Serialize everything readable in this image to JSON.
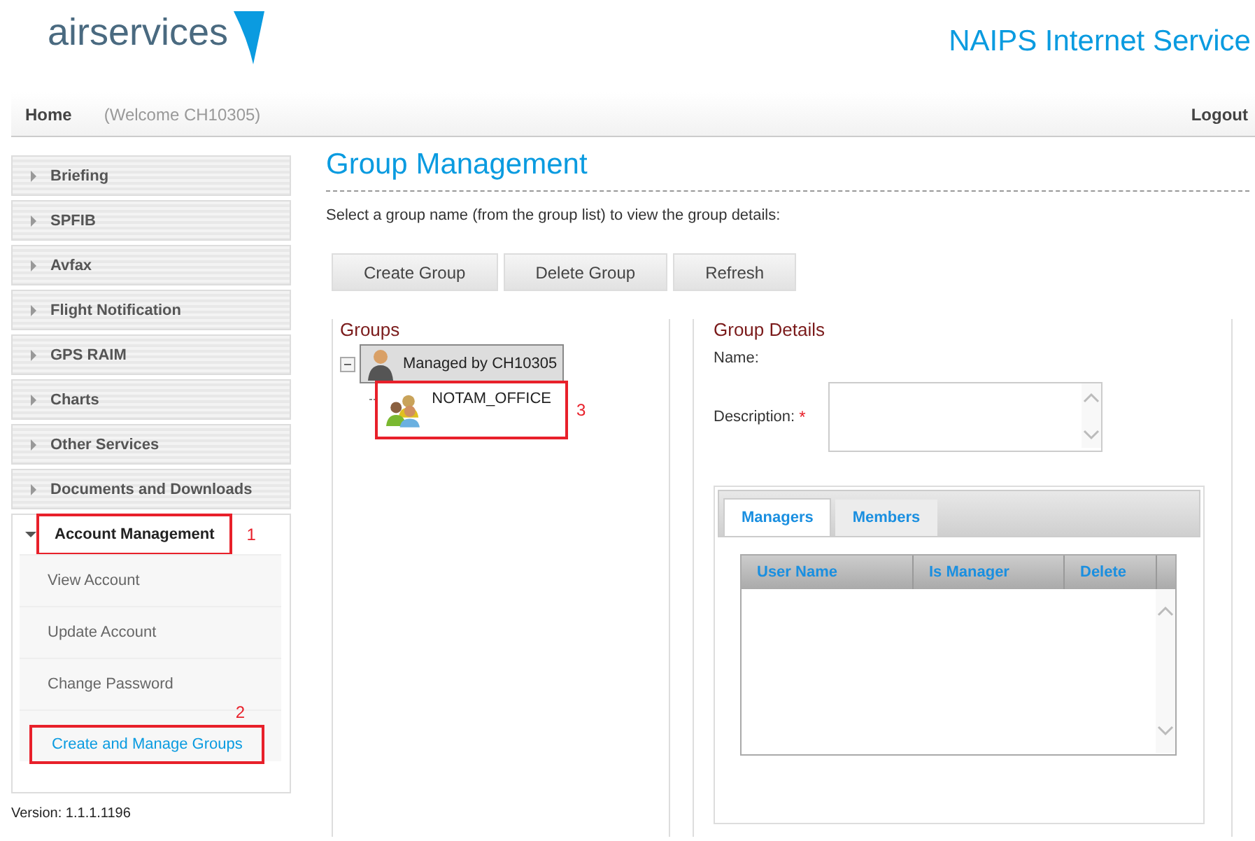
{
  "header": {
    "logo": "airservices",
    "service_title": "NAIPS Internet Service"
  },
  "nav": {
    "home": "Home",
    "welcome": "(Welcome CH10305)",
    "logout": "Logout"
  },
  "sidebar": {
    "items": [
      {
        "label": "Briefing",
        "expanded": false
      },
      {
        "label": "SPFIB",
        "expanded": false
      },
      {
        "label": "Avfax",
        "expanded": false
      },
      {
        "label": "Flight Notification",
        "expanded": false
      },
      {
        "label": "GPS RAIM",
        "expanded": false
      },
      {
        "label": "Charts",
        "expanded": false
      },
      {
        "label": "Other Services",
        "expanded": false
      },
      {
        "label": "Documents and Downloads",
        "expanded": false
      },
      {
        "label": "Account Management",
        "expanded": true,
        "callout": "1",
        "children": [
          {
            "label": "View Account",
            "selected": false
          },
          {
            "label": "Update Account",
            "selected": false
          },
          {
            "label": "Change Password",
            "selected": false
          },
          {
            "label": "Create and Manage Groups",
            "selected": true,
            "callout": "2"
          }
        ]
      }
    ],
    "version": "Version: 1.1.1.1196"
  },
  "page": {
    "title": "Group Management",
    "instruction": "Select a group name (from the group list) to view the group details:",
    "buttons": [
      "Create Group",
      "Delete Group",
      "Refresh"
    ]
  },
  "groups": {
    "heading": "Groups",
    "tree": {
      "label": "Managed by CH10305",
      "expanded": true,
      "children": [
        {
          "label": "NOTAM_OFFICE",
          "callout": "3"
        }
      ]
    }
  },
  "details": {
    "heading": "Group Details",
    "name_label": "Name:",
    "description_label": "Description:",
    "required_mark": "*",
    "tabs": [
      {
        "label": "Managers",
        "selected": true
      },
      {
        "label": "Members",
        "selected": false
      }
    ],
    "columns": [
      "User Name",
      "Is Manager",
      "Delete"
    ]
  }
}
